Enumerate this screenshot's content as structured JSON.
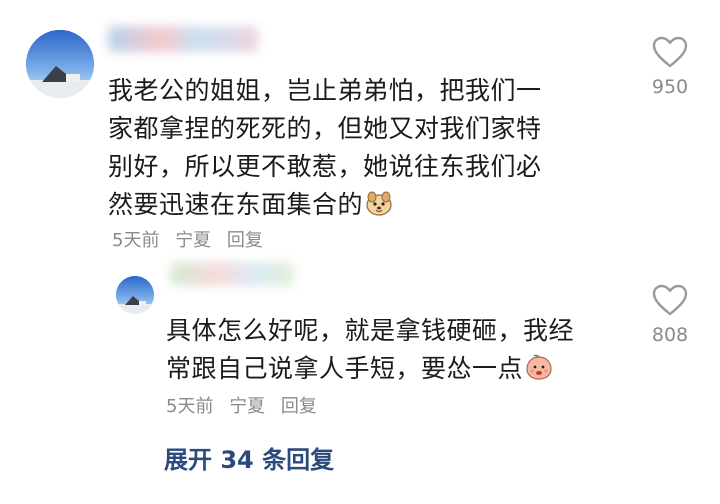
{
  "main_comment": {
    "username": "",
    "text_lines": [
      "我老公的姐姐，岂止弟弟怕，把我们一",
      "家都拿捏的死死的，但她又对我们家特",
      "别好，所以更不敢惹，她说往东我们必",
      "然要迅速在东面集合的"
    ],
    "emoji": "dog-face-emoji",
    "time": "5天前",
    "location": "宁夏",
    "reply_label": "回复",
    "like_count": "950"
  },
  "reply_comment": {
    "username": "",
    "text_lines": [
      "具体怎么好呢，就是拿钱硬砸，我经",
      "常跟自己说拿人手短，要怂一点"
    ],
    "emoji": "peach-face-emoji",
    "time": "5天前",
    "location": "宁夏",
    "reply_label": "回复",
    "like_count": "808"
  },
  "expand_replies": {
    "label": "展开 34 条回复"
  },
  "colors": {
    "text": "#1b1b1b",
    "meta": "#8a8a8a",
    "link": "#2a4a7d"
  }
}
